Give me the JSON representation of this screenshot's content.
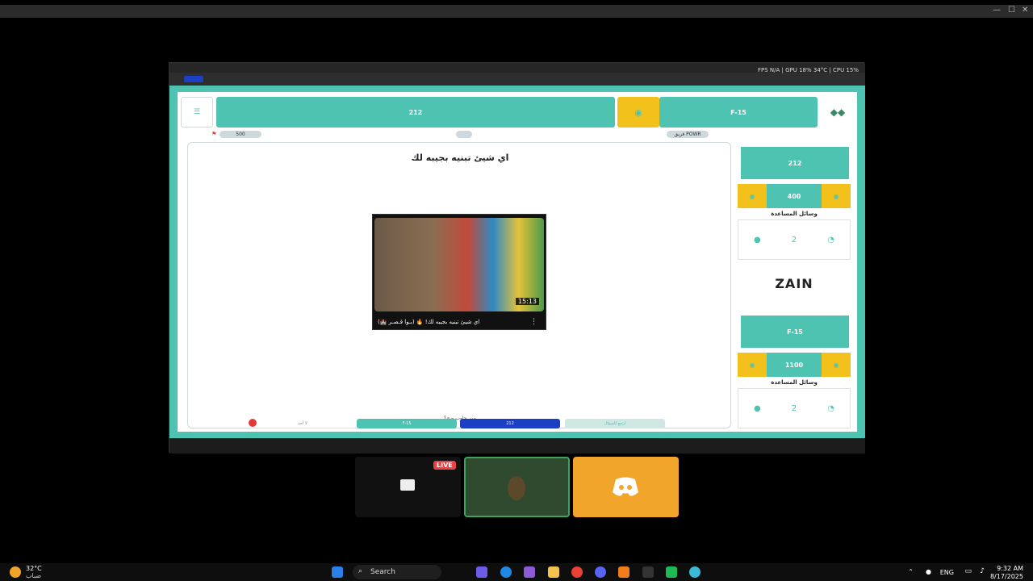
{
  "game": {
    "left_score": "212",
    "right_team": "F-15",
    "pill_left": "500",
    "pill_right": "فريق POWR",
    "question": "اي شيئ تبنيه بجيبه لك",
    "video": {
      "duration": "15:13",
      "caption": "اي شيئ تبنيه بجيبه لك! 🔥 (بـوا قـصـر 🏰)"
    },
    "side": {
      "team1_name": "212",
      "team1_score": "400",
      "helpers_label": "وسائل المساعدة",
      "sponsor": "ZAIN",
      "team2_name": "F-15",
      "team2_score": "1100"
    },
    "bottom": {
      "who_answered": "مين جاوب صح؟",
      "team_a": "F-15",
      "team_b": "212",
      "back": "ارجع للسؤال",
      "none": "لا أحد"
    }
  },
  "inner_fps": "FPS N/A | GPU 18% 34°C | CPU 15%",
  "participants": {
    "live": "LIVE"
  },
  "taskbar": {
    "weather_temp": "32°C",
    "weather_desc": "ضباب",
    "search": "Search",
    "lang": "ENG",
    "time": "9:32 AM",
    "date": "8/17/2025"
  },
  "colors": {
    "teal": "#4fc3b2",
    "gold": "#f3c11b",
    "blue": "#1d3fc4",
    "discord": "#f1a52a"
  }
}
